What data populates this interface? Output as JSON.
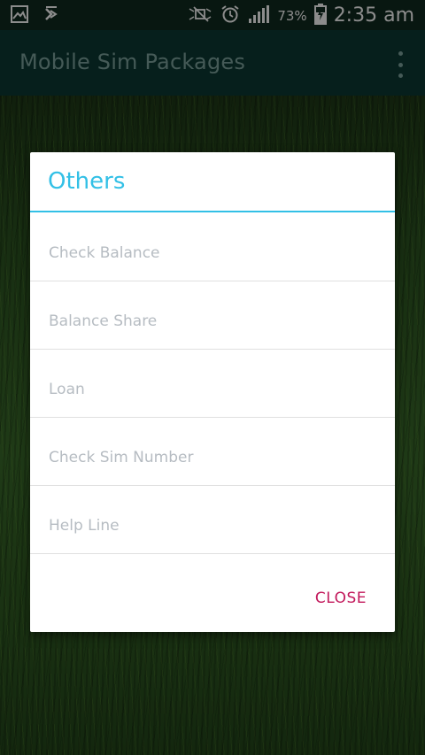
{
  "status_bar": {
    "left_icons": [
      "gallery-icon",
      "download-icon"
    ],
    "right_icons": [
      "mute-icon",
      "alarm-icon",
      "signal-icon",
      "battery-charging-icon"
    ],
    "battery": "73%",
    "time": "2:35 am"
  },
  "app_bar": {
    "title": "Mobile Sim Packages",
    "menu_icon": "overflow-menu-icon"
  },
  "dialog": {
    "title": "Others",
    "items": [
      {
        "label": "Check Balance"
      },
      {
        "label": "Balance Share"
      },
      {
        "label": "Loan"
      },
      {
        "label": "Check Sim Number"
      },
      {
        "label": "Help Line"
      }
    ],
    "close_label": "CLOSE"
  },
  "colors": {
    "app_bar": "#0c3a34",
    "status_bar": "#0f2a1f",
    "dialog_accent": "#33c0e6",
    "close_button": "#c2185b",
    "item_text": "#b6bcc2"
  }
}
